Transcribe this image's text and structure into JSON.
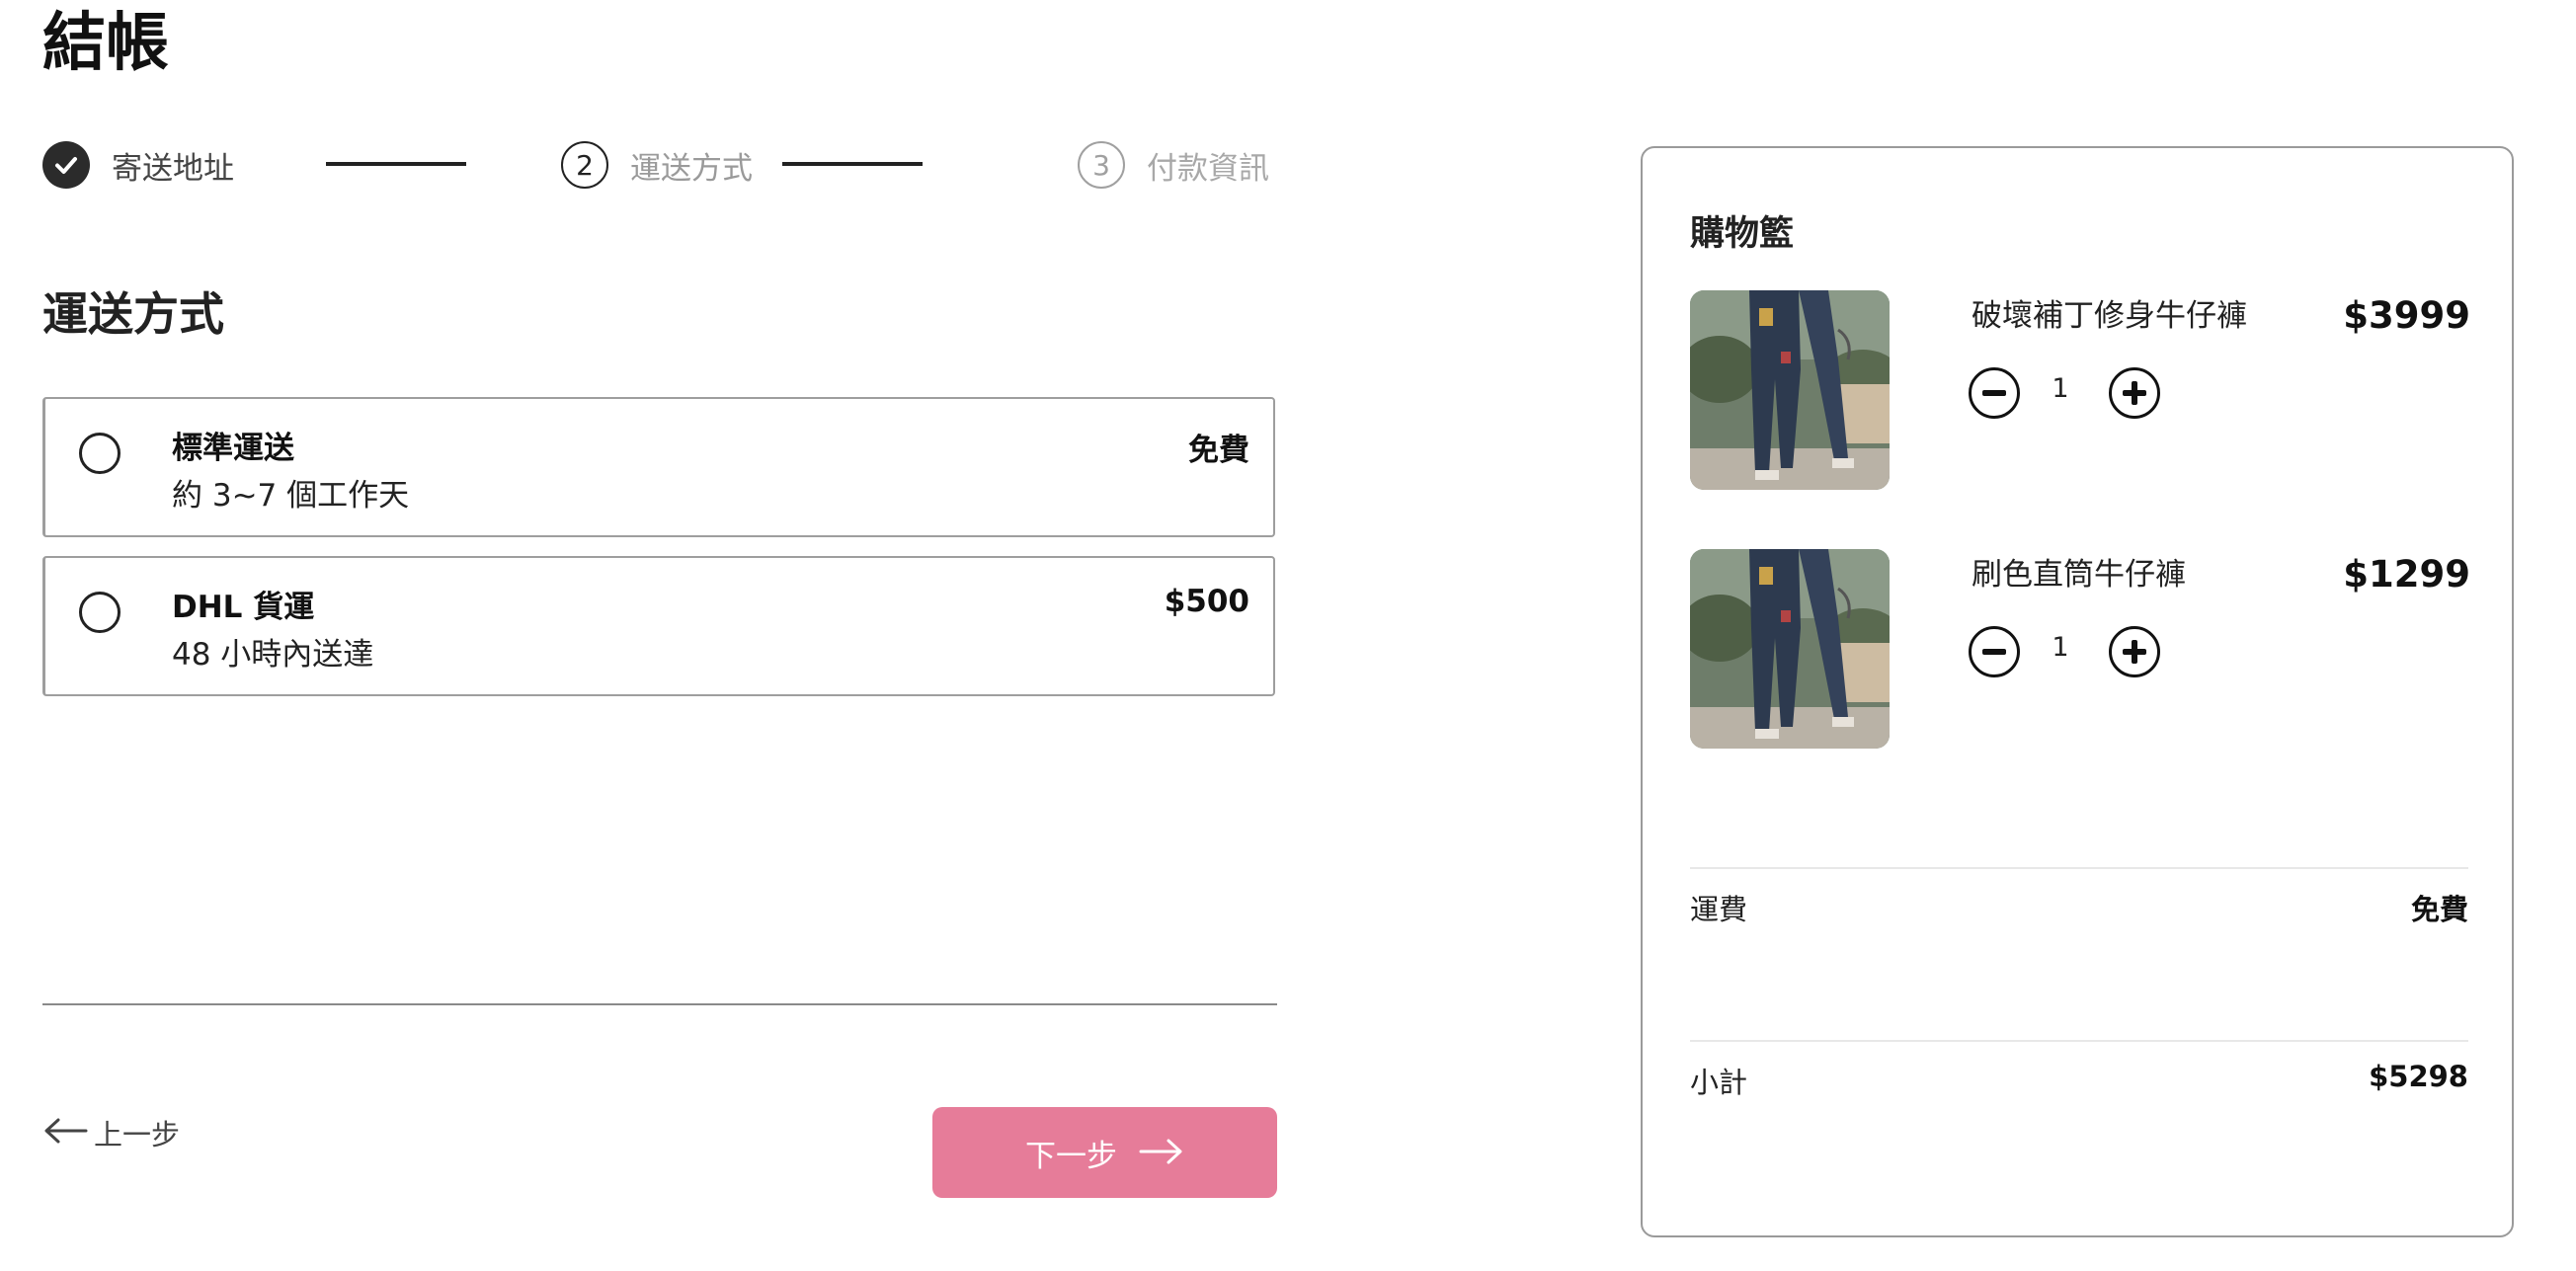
{
  "page": {
    "title": "結帳"
  },
  "stepper": {
    "steps": [
      {
        "number": "",
        "label": "寄送地址",
        "state": "done",
        "icon": "check-icon"
      },
      {
        "number": "2",
        "label": "運送方式",
        "state": "active"
      },
      {
        "number": "3",
        "label": "付款資訊",
        "state": "todo"
      }
    ]
  },
  "shipping": {
    "section_title": "運送方式",
    "options": [
      {
        "name": "標準運送",
        "description": "約 3~7 個工作天",
        "price": "免費",
        "selected": false
      },
      {
        "name": "DHL 貨運",
        "description": "48 小時內送達",
        "price": "$500",
        "selected": false
      }
    ]
  },
  "navigation": {
    "back_label": "上一步",
    "next_label": "下一步",
    "back_icon": "arrow-left-icon",
    "next_icon": "arrow-right-icon"
  },
  "cart": {
    "title": "購物籃",
    "items": [
      {
        "name": "破壞補丁修身牛仔褲",
        "price": "$3999",
        "quantity": "1"
      },
      {
        "name": "刷色直筒牛仔褲",
        "price": "$1299",
        "quantity": "1"
      }
    ],
    "shipping_label": "運費",
    "shipping_value": "免費",
    "subtotal_label": "小計",
    "subtotal_value": "$5298"
  },
  "colors": {
    "accent": "#e67c99",
    "text": "#222222",
    "muted": "#a0a0a0",
    "border": "#9e9e9e"
  }
}
